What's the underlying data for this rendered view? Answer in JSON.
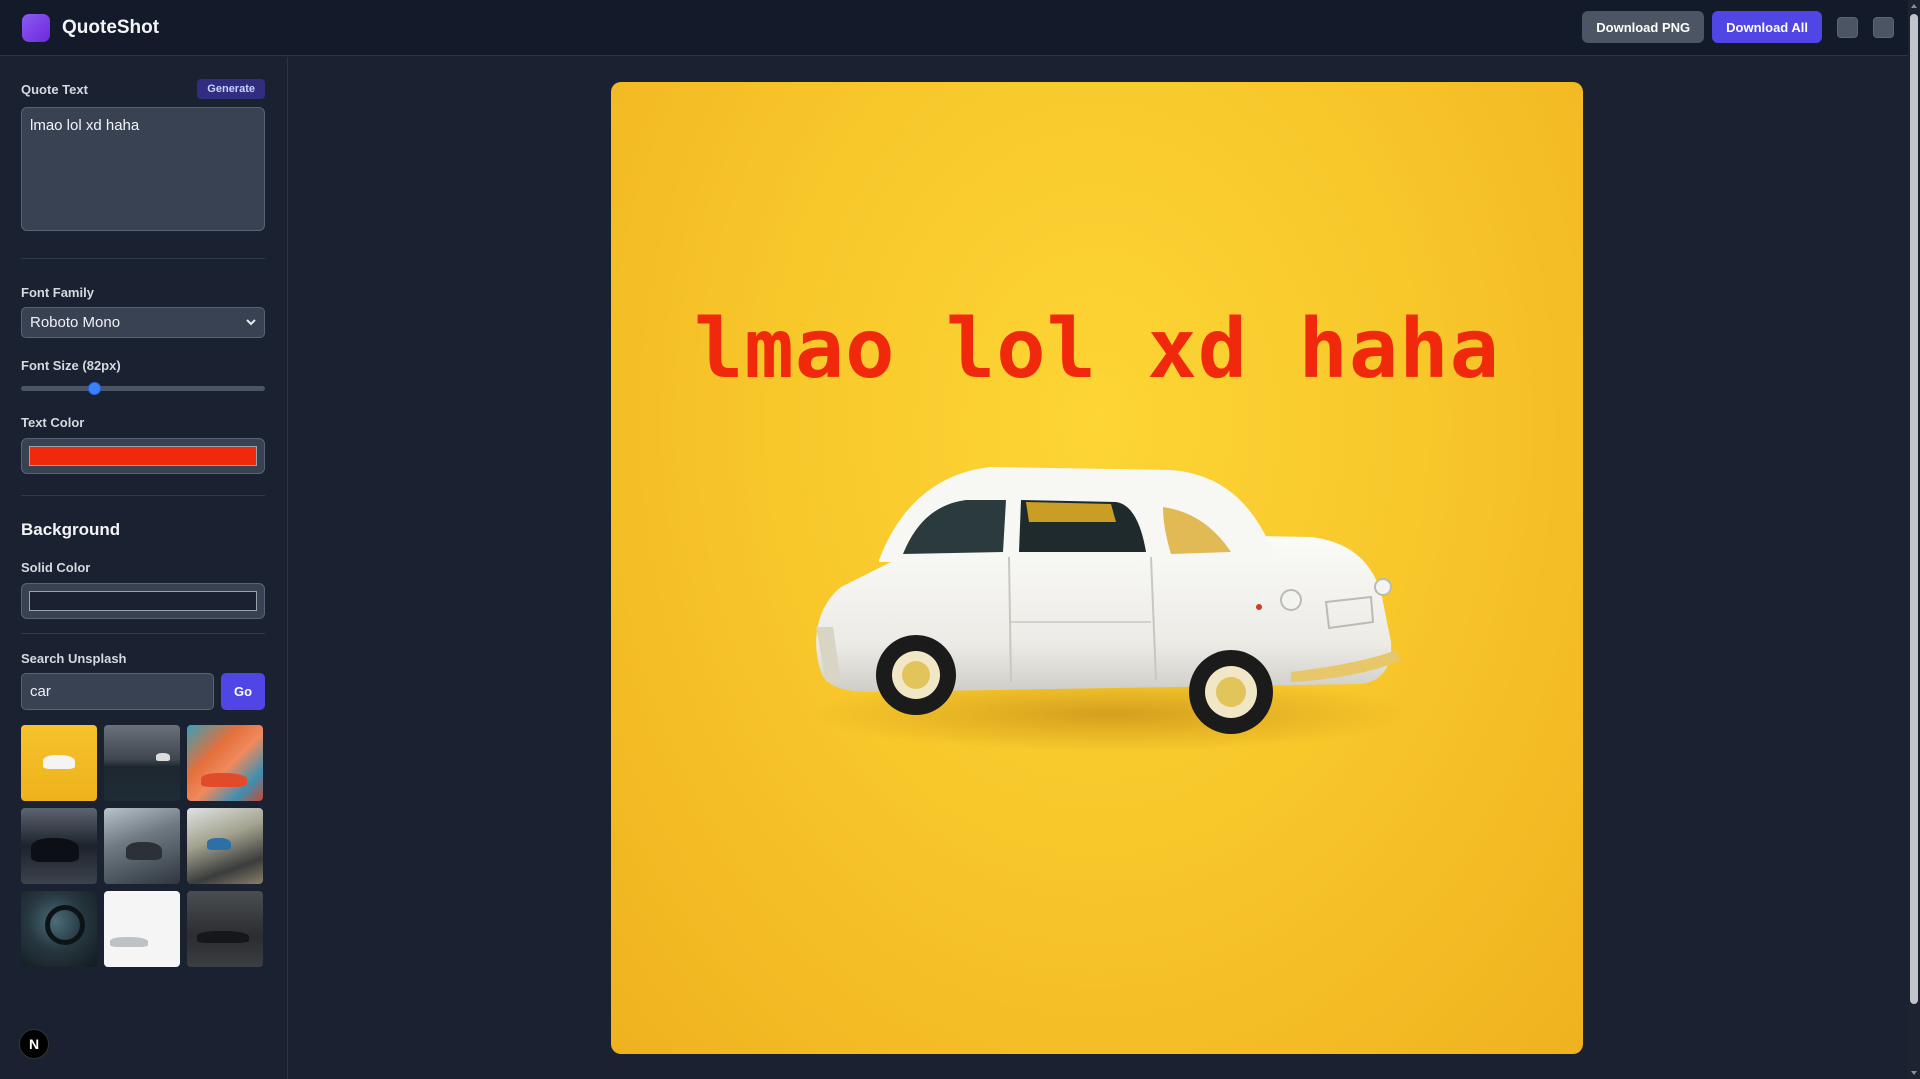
{
  "header": {
    "app_title": "QuoteShot",
    "download_png_label": "Download PNG",
    "download_all_label": "Download All"
  },
  "sidebar": {
    "quote_label": "Quote Text",
    "generate_label": "Generate",
    "quote_value": "lmao lol xd haha",
    "font_family_label": "Font Family",
    "font_family_value": "Roboto Mono",
    "font_size_label": "Font Size (82px)",
    "font_size_slider_fraction": 0.29,
    "text_color_label": "Text Color",
    "text_color_value": "#f1290c",
    "background_title": "Background",
    "solid_color_label": "Solid Color",
    "solid_color_value": "#1a2231",
    "search_label": "Search Unsplash",
    "search_value": "car",
    "go_label": "Go",
    "thumbnails": [
      "yellow-car",
      "dark-road-car",
      "graffiti-car",
      "black-car-garage",
      "grey-car-fog",
      "blue-car-coast",
      "steering-wheel",
      "white-car-studio",
      "dark-sedan"
    ]
  },
  "canvas": {
    "quote_text": "lmao lol xd haha",
    "text_color": "#f1290c",
    "background_color": "#f8c82b"
  },
  "badge": {
    "letter": "N"
  }
}
